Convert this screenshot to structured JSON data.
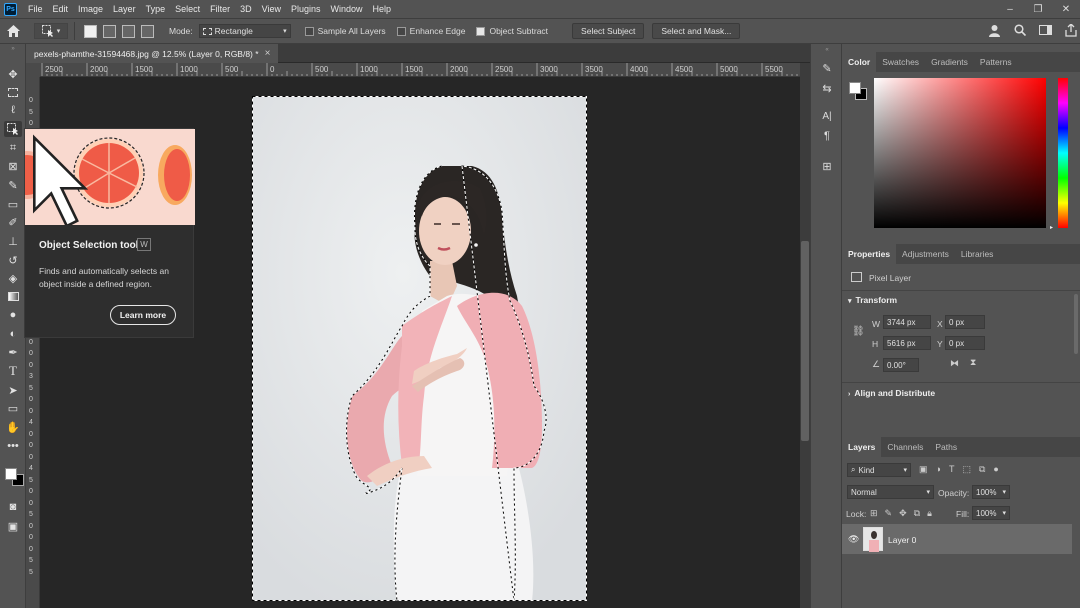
{
  "app": {
    "logo": "Ps"
  },
  "menu": [
    "File",
    "Edit",
    "Image",
    "Layer",
    "Type",
    "Select",
    "Filter",
    "3D",
    "View",
    "Plugins",
    "Window",
    "Help"
  ],
  "window_controls": {
    "minimize": "–",
    "restore": "❐",
    "close": "✕"
  },
  "options": {
    "mode_label": "Mode:",
    "mode_value": "Rectangle",
    "sample_all_layers": "Sample All Layers",
    "enhance_edge": "Enhance Edge",
    "object_subtract": "Object Subtract",
    "select_subject": "Select Subject",
    "select_and_mask": "Select and Mask..."
  },
  "document": {
    "tab_title": "pexels-phamthe-31594468.jpg @ 12.5% (Layer 0, RGB/8) *",
    "close": "×"
  },
  "ruler": {
    "top_ticks": [
      "2500",
      "2000",
      "1500",
      "1000",
      "500",
      "0",
      "500",
      "1000",
      "1500",
      "2000",
      "2500",
      "3000",
      "3500",
      "4000",
      "4500",
      "5000",
      "5500",
      "60"
    ],
    "left_ticks": [
      "0",
      "5",
      "0",
      "0",
      "1",
      "0",
      "0",
      "0",
      "1",
      "5",
      "0",
      "0",
      "2",
      "0",
      "0",
      "0",
      "2",
      "5",
      "0",
      "0",
      "3",
      "0",
      "0",
      "0",
      "3",
      "5",
      "0",
      "0",
      "4",
      "0",
      "0",
      "0",
      "4",
      "5",
      "0",
      "0",
      "5",
      "0",
      "0",
      "0",
      "5",
      "5"
    ]
  },
  "tooltip": {
    "title": "Object Selection tool",
    "shortcut": "W",
    "description": "Finds and automatically selects an object inside a defined region.",
    "button": "Learn more"
  },
  "color_panel": {
    "tabs": [
      "Color",
      "Swatches",
      "Gradients",
      "Patterns"
    ],
    "active": "Color",
    "hue": "#ff0000"
  },
  "properties": {
    "tabs": [
      "Properties",
      "Adjustments",
      "Libraries"
    ],
    "active": "Properties",
    "layer_type": "Pixel Layer",
    "transform_title": "Transform",
    "w_label": "W",
    "w_value": "3744 px",
    "h_label": "H",
    "h_value": "5616 px",
    "x_label": "X",
    "x_value": "0 px",
    "y_label": "Y",
    "y_value": "0 px",
    "angle_value": "0.00°",
    "align_title": "Align and Distribute"
  },
  "layers": {
    "tabs": [
      "Layers",
      "Channels",
      "Paths"
    ],
    "active": "Layers",
    "filter_kind": "Kind",
    "blend_mode": "Normal",
    "opacity_label": "Opacity:",
    "opacity_value": "100%",
    "lock_label": "Lock:",
    "fill_label": "Fill:",
    "fill_value": "100%",
    "items": [
      {
        "name": "Layer 0",
        "visible": true
      }
    ]
  }
}
